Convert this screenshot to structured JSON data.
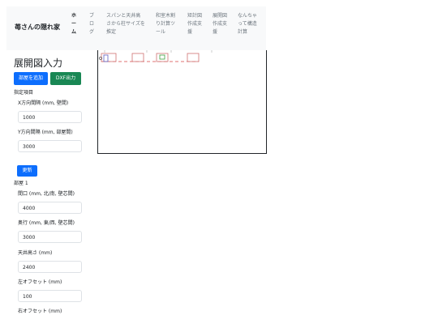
{
  "navbar": {
    "brand": "苺さんの隠れ家",
    "items": [
      {
        "label": "ホーム",
        "active": true
      },
      {
        "label": "ブログ",
        "active": false
      },
      {
        "label": "スパンと天井高さから柱サイズを推定",
        "active": false
      },
      {
        "label": "和室木割り計算ツール",
        "active": false
      },
      {
        "label": "矩計図作成支援",
        "active": false
      },
      {
        "label": "展開図作成支援",
        "active": false
      },
      {
        "label": "なんちゃって構造計算",
        "active": false
      }
    ]
  },
  "main": {
    "title": "展開図入力",
    "add_room_button": "部屋を追加",
    "dxf_button": "DXF出力",
    "specified_section": "指定項目",
    "x_spacing_label": "X方向間隔 (mm, 壁間)",
    "x_spacing_value": "1000",
    "y_spacing_label": "Y方向間隔 (mm, 部屋間)",
    "y_spacing_value": "3000",
    "update_button": "更新",
    "room_section": "部屋 1",
    "frontage_label": "間口 (mm, 北/南, 壁芯間)",
    "frontage_value": "4000",
    "depth_label": "奥行 (mm, 東/西, 壁芯間)",
    "depth_value": "3000",
    "ceiling_label": "天井高さ (mm)",
    "ceiling_value": "2400",
    "left_offset_label": "左オフセット (mm)",
    "left_offset_value": "100",
    "right_offset_label": "右オフセット (mm)"
  },
  "colors": {
    "primary": "#0d6efd",
    "success": "#198754",
    "navbar_bg": "#f8f9fa",
    "drawing_dash": "#e07070",
    "drawing_room": "#d07070",
    "drawing_window": "#6060c0",
    "drawing_window_green": "#40a040"
  }
}
